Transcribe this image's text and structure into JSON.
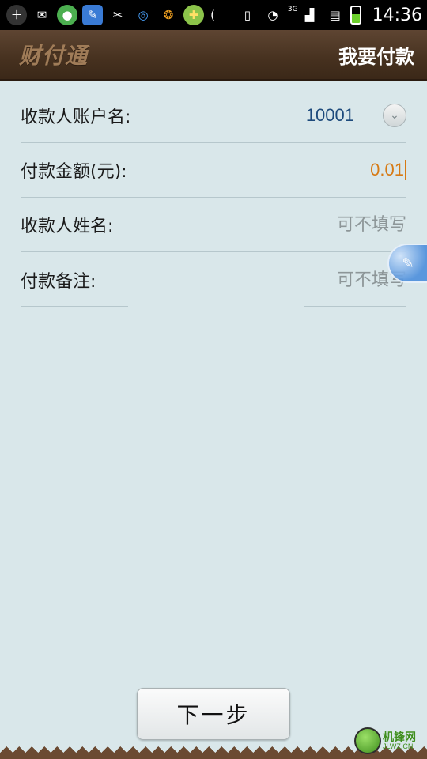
{
  "status_bar": {
    "time": "14:36",
    "network_label": "3G",
    "icons": [
      "add-icon",
      "mail-icon",
      "app-icon",
      "tool-icon",
      "clean-icon",
      "chat-icon",
      "browser-icon",
      "store-icon",
      "phone-icon",
      "wifi-icon",
      "signal-icon",
      "sd-icon",
      "battery-icon"
    ]
  },
  "header": {
    "logo_text": "财付通",
    "title": "我要付款"
  },
  "form": {
    "account": {
      "label": "收款人账户名:",
      "value": "10001"
    },
    "amount": {
      "label": "付款金额(元):",
      "value": "0.01"
    },
    "payee_name": {
      "label": "收款人姓名:",
      "placeholder": "可不填写"
    },
    "note": {
      "label": "付款备注:",
      "placeholder": "可不填写"
    }
  },
  "next_button": {
    "label": "下一步"
  },
  "watermark": {
    "cn": "机锋网",
    "en": "JLWZ.CN"
  },
  "colors": {
    "background": "#d9e7ea",
    "header": "#46311f",
    "amount_text": "#d77a14",
    "account_text": "#1d4a7c",
    "placeholder_text": "#8d9698"
  }
}
